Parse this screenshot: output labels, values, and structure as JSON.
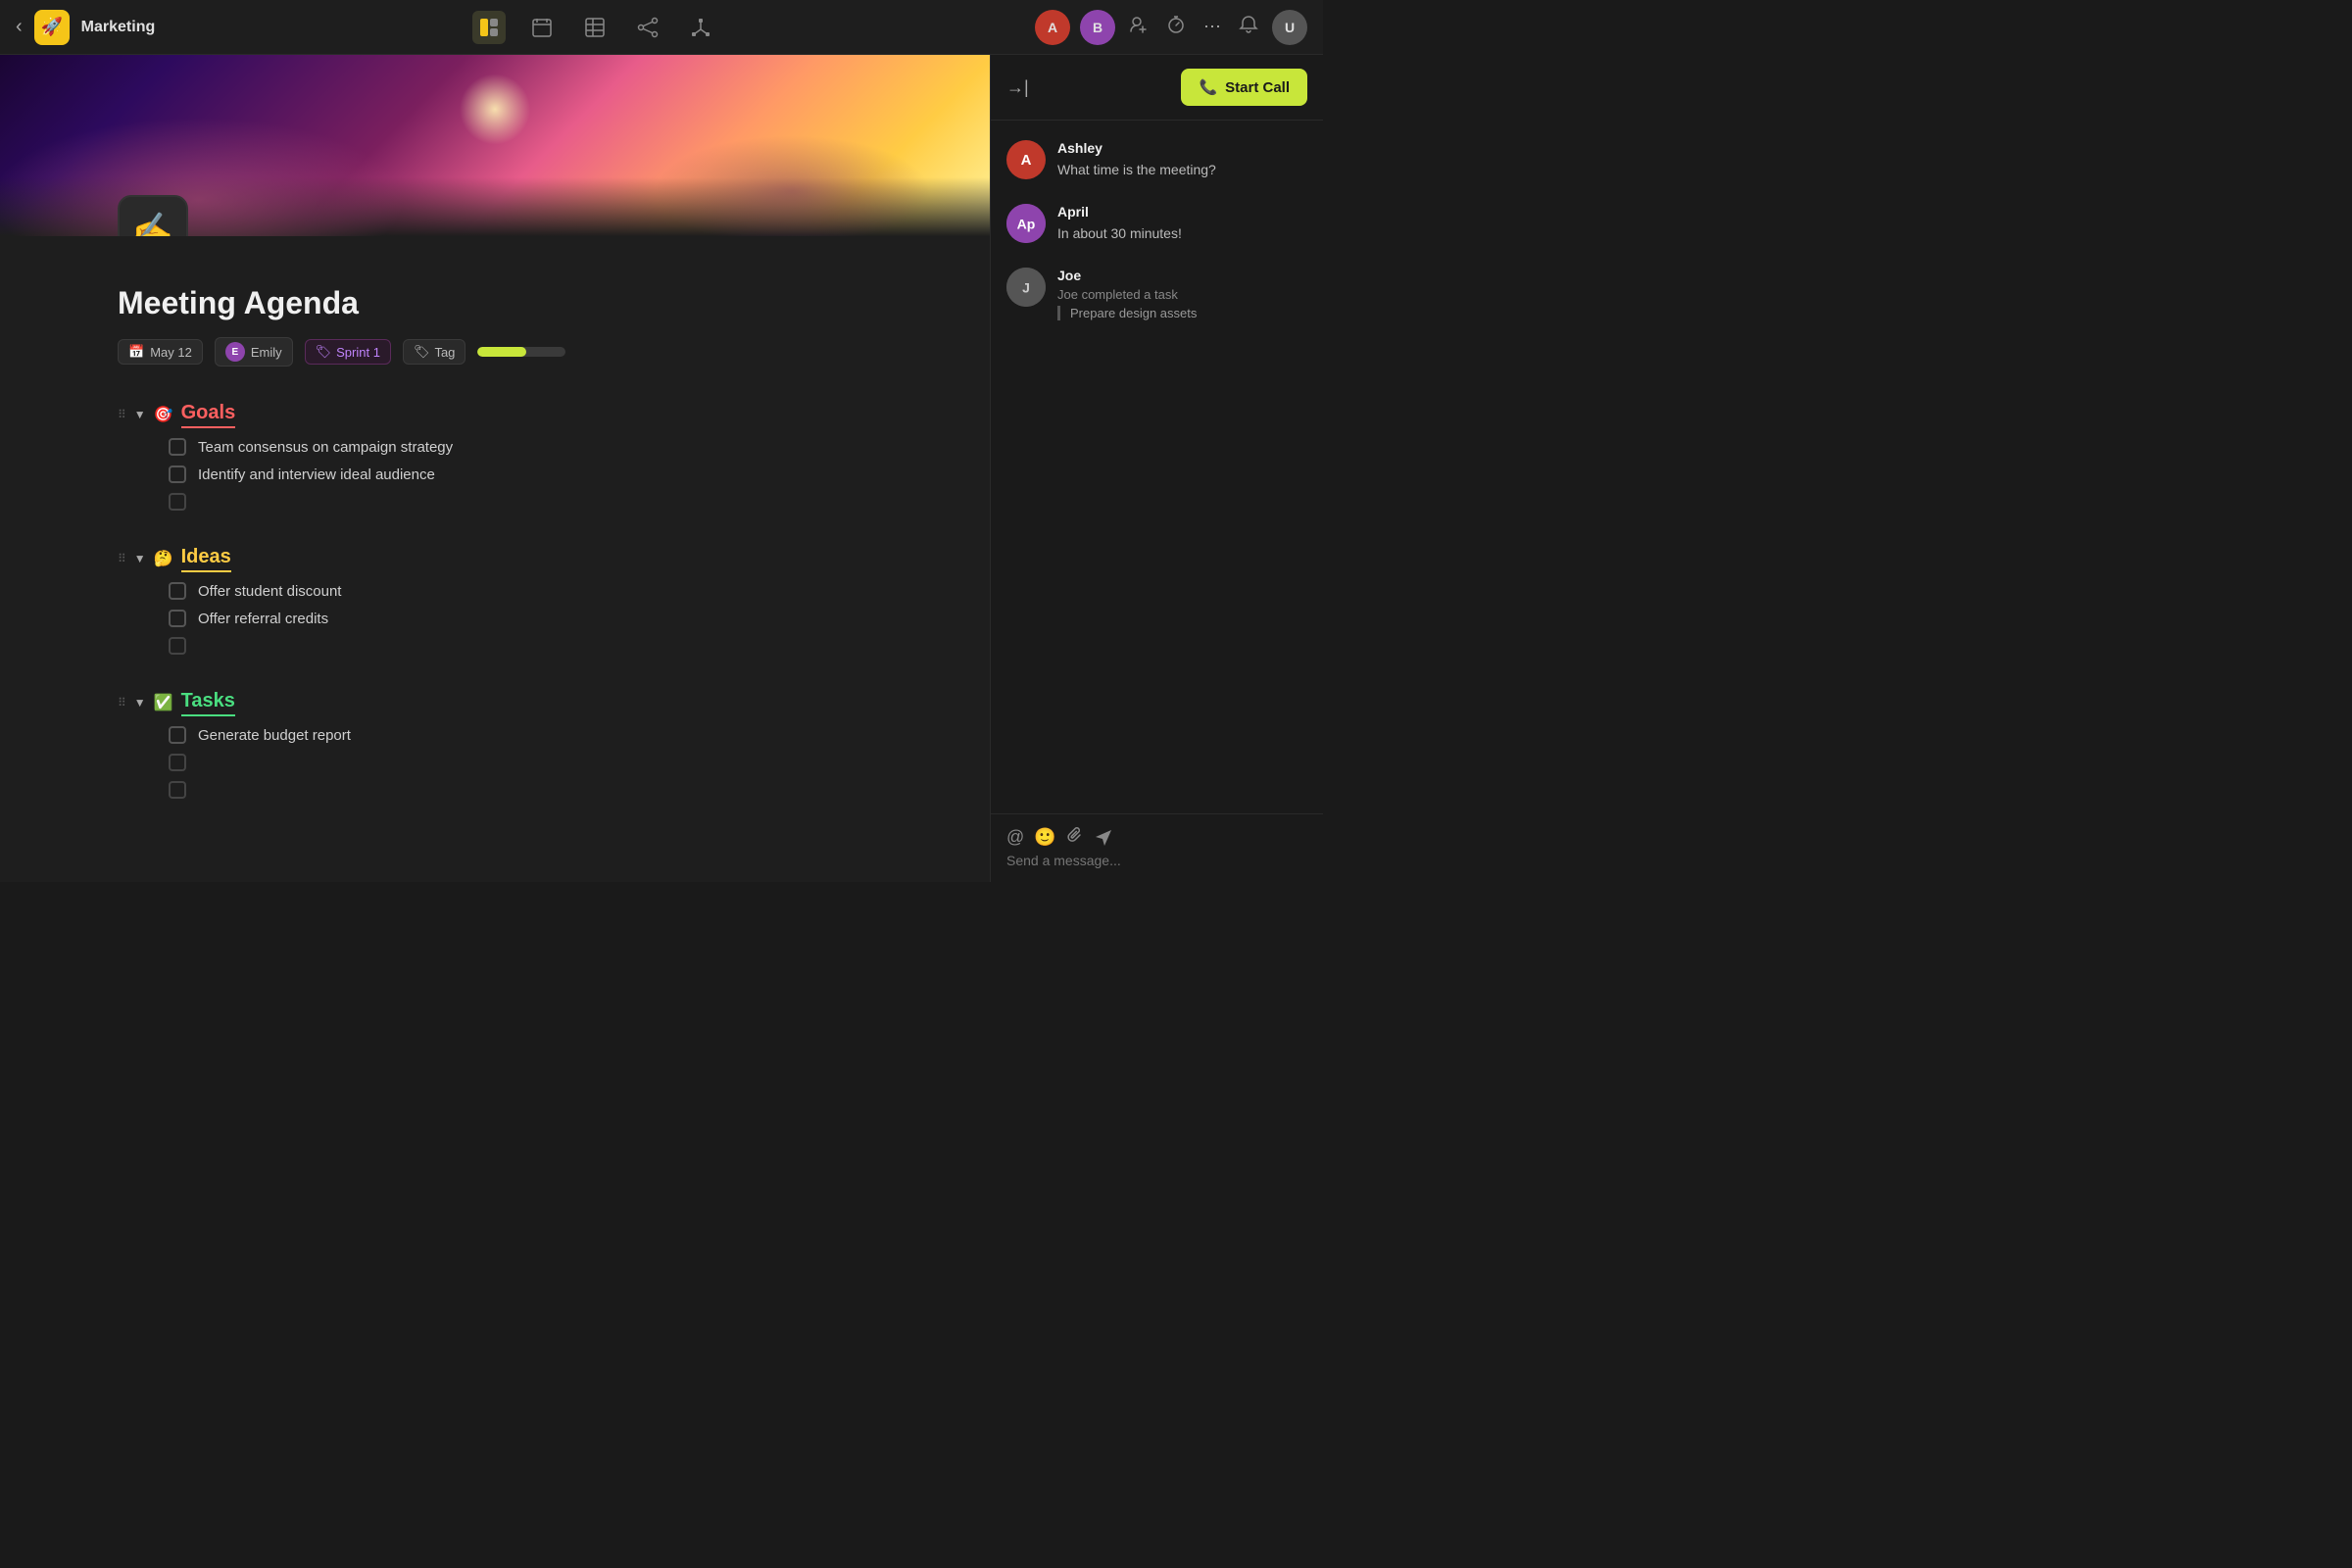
{
  "nav": {
    "back_label": "‹",
    "logo_emoji": "🚀",
    "title": "Marketing",
    "tools": [
      {
        "id": "split",
        "icon": "⊟",
        "active": true
      },
      {
        "id": "calendar",
        "icon": "⊞",
        "active": false
      },
      {
        "id": "table",
        "icon": "⊠",
        "active": false
      },
      {
        "id": "share",
        "icon": "⊛",
        "active": false
      },
      {
        "id": "org",
        "icon": "⊕",
        "active": false
      }
    ],
    "right_icons": [
      "👤+",
      "⏱",
      "⊙",
      "⋯",
      "🔔"
    ],
    "avatar1_initials": "A",
    "avatar2_initials": "B"
  },
  "hero": {
    "doc_icon": "✍️"
  },
  "doc": {
    "title": "Meeting Agenda",
    "meta": {
      "date": "May 12",
      "assignee": "Emily",
      "sprint": "Sprint 1",
      "tag": "Tag"
    },
    "sections": [
      {
        "id": "goals",
        "emoji": "🎯",
        "title": "Goals",
        "color_class": "goals-title",
        "items": [
          {
            "text": "Team consensus on campaign strategy"
          },
          {
            "text": "Identify and interview ideal audience"
          },
          {
            "text": ""
          }
        ]
      },
      {
        "id": "ideas",
        "emoji": "🤔",
        "title": "Ideas",
        "color_class": "ideas-title",
        "items": [
          {
            "text": "Offer student discount"
          },
          {
            "text": "Offer referral credits"
          },
          {
            "text": ""
          }
        ]
      },
      {
        "id": "tasks",
        "emoji": "✅",
        "title": "Tasks",
        "color_class": "tasks-title",
        "items": [
          {
            "text": "Generate budget report"
          },
          {
            "text": ""
          },
          {
            "text": ""
          }
        ]
      }
    ]
  },
  "panel": {
    "collapse_icon": "→|",
    "start_call_label": "Start Call",
    "phone_icon": "📞",
    "messages": [
      {
        "id": "ashley",
        "name": "Ashley",
        "avatar_class": "msg-avatar-ashley",
        "avatar_text": "A",
        "text": "What time is the meeting?",
        "type": "text"
      },
      {
        "id": "april",
        "name": "April",
        "avatar_class": "msg-avatar-april",
        "avatar_text": "Ap",
        "text": "In about 30 minutes!",
        "type": "text"
      },
      {
        "id": "joe",
        "name": "Joe",
        "avatar_class": "msg-avatar-joe",
        "avatar_text": "J",
        "text": "Joe completed a task",
        "task_quote": "Prepare design assets",
        "type": "task"
      }
    ],
    "input_placeholder": "Send a message...",
    "input_icons": [
      "@",
      "😊",
      "↑"
    ]
  }
}
